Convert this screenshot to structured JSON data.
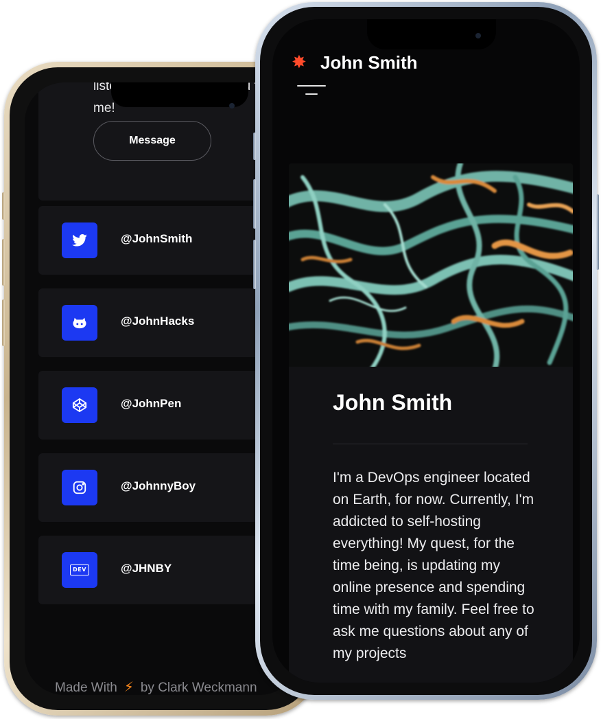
{
  "back_phone": {
    "intro_text": "listed everywhere else, you find me!",
    "message_button": "Message",
    "socials": [
      {
        "icon": "twitter-icon",
        "icon_text": "",
        "handle": "@JohnSmith"
      },
      {
        "icon": "github-icon",
        "icon_text": "",
        "handle": "@JohnHacks"
      },
      {
        "icon": "codepen-icon",
        "icon_text": "",
        "handle": "@JohnPen"
      },
      {
        "icon": "instagram-icon",
        "icon_text": "",
        "handle": "@JohnnyBoy"
      },
      {
        "icon": "dev-icon",
        "icon_text": "DEV",
        "handle": "@JHNBY"
      }
    ],
    "footer": {
      "made_with": "Made With",
      "by": "by Clark Weckmann"
    }
  },
  "front_phone": {
    "brand_name": "John Smith",
    "profile": {
      "name": "John Smith",
      "bio": "I'm a DevOps engineer located on Earth, for now. Currently, I'm addicted to self-hosting everything! My quest, for the time being, is updating my online presence and spending time with my family. Feel free to ask me questions about any of my projects"
    }
  },
  "colors": {
    "accent_blue": "#1c39f2",
    "bolt_orange": "#ff8a1c",
    "brand_star": "#ff4b2b",
    "card_bg": "#151518"
  }
}
